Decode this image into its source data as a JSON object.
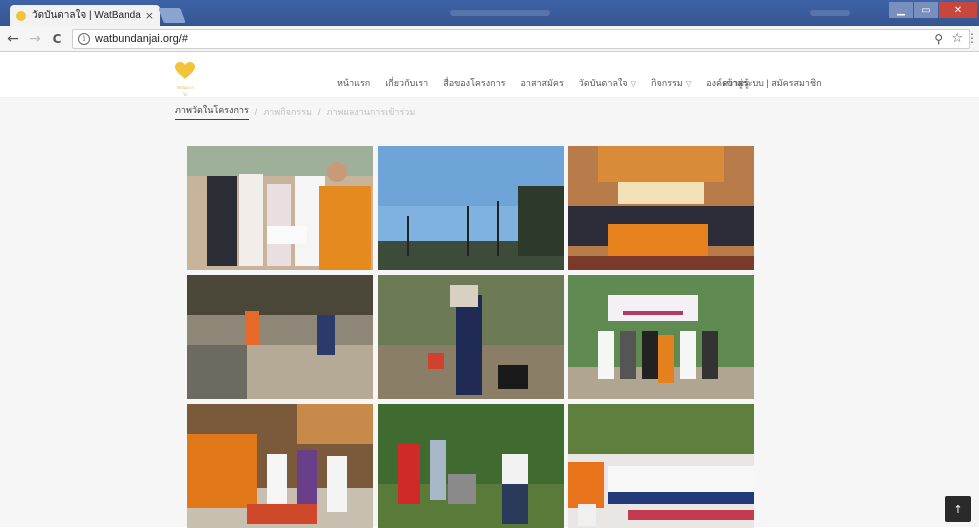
{
  "browser": {
    "tab_title": "วัดบันดาลใจ | WatBandanj",
    "tab_close": "×",
    "url": "watbundanjai.org/#",
    "info_symbol": "i",
    "back": "←",
    "forward": "→",
    "reload": "C",
    "zoom_symbol": "⚲",
    "star_symbol": "☆",
    "menu_symbol": "⋮",
    "window_buttons": [
      "▁",
      "▭",
      "✕"
    ]
  },
  "site": {
    "brand_caption": "วัดบันดาลใจ",
    "nav": [
      {
        "label": "หน้าแรก",
        "dropdown": false
      },
      {
        "label": "เกี่ยวกับเรา",
        "dropdown": false
      },
      {
        "label": "สื่อของโครงการ",
        "dropdown": false
      },
      {
        "label": "อาสาสมัคร",
        "dropdown": false
      },
      {
        "label": "วัดบันดาลใจ",
        "dropdown": true
      },
      {
        "label": "กิจกรรม",
        "dropdown": true
      },
      {
        "label": "องค์ความรู้",
        "dropdown": false
      }
    ],
    "auth": "เข้าสู่ระบบ | สมัครสมาชิก",
    "filters": [
      {
        "label": "ภาพวัดในโครงการ",
        "active": true
      },
      {
        "label": "ภาพกิจกรรม",
        "active": false
      },
      {
        "label": "ภาพผลงานการเข้าร่วม",
        "active": false
      }
    ],
    "filter_separator": "/",
    "to_top": "↑"
  },
  "colors": {
    "chrome": "#3b5b9a",
    "accent": "#f4c33c",
    "monk_robe": "#e0801c"
  }
}
